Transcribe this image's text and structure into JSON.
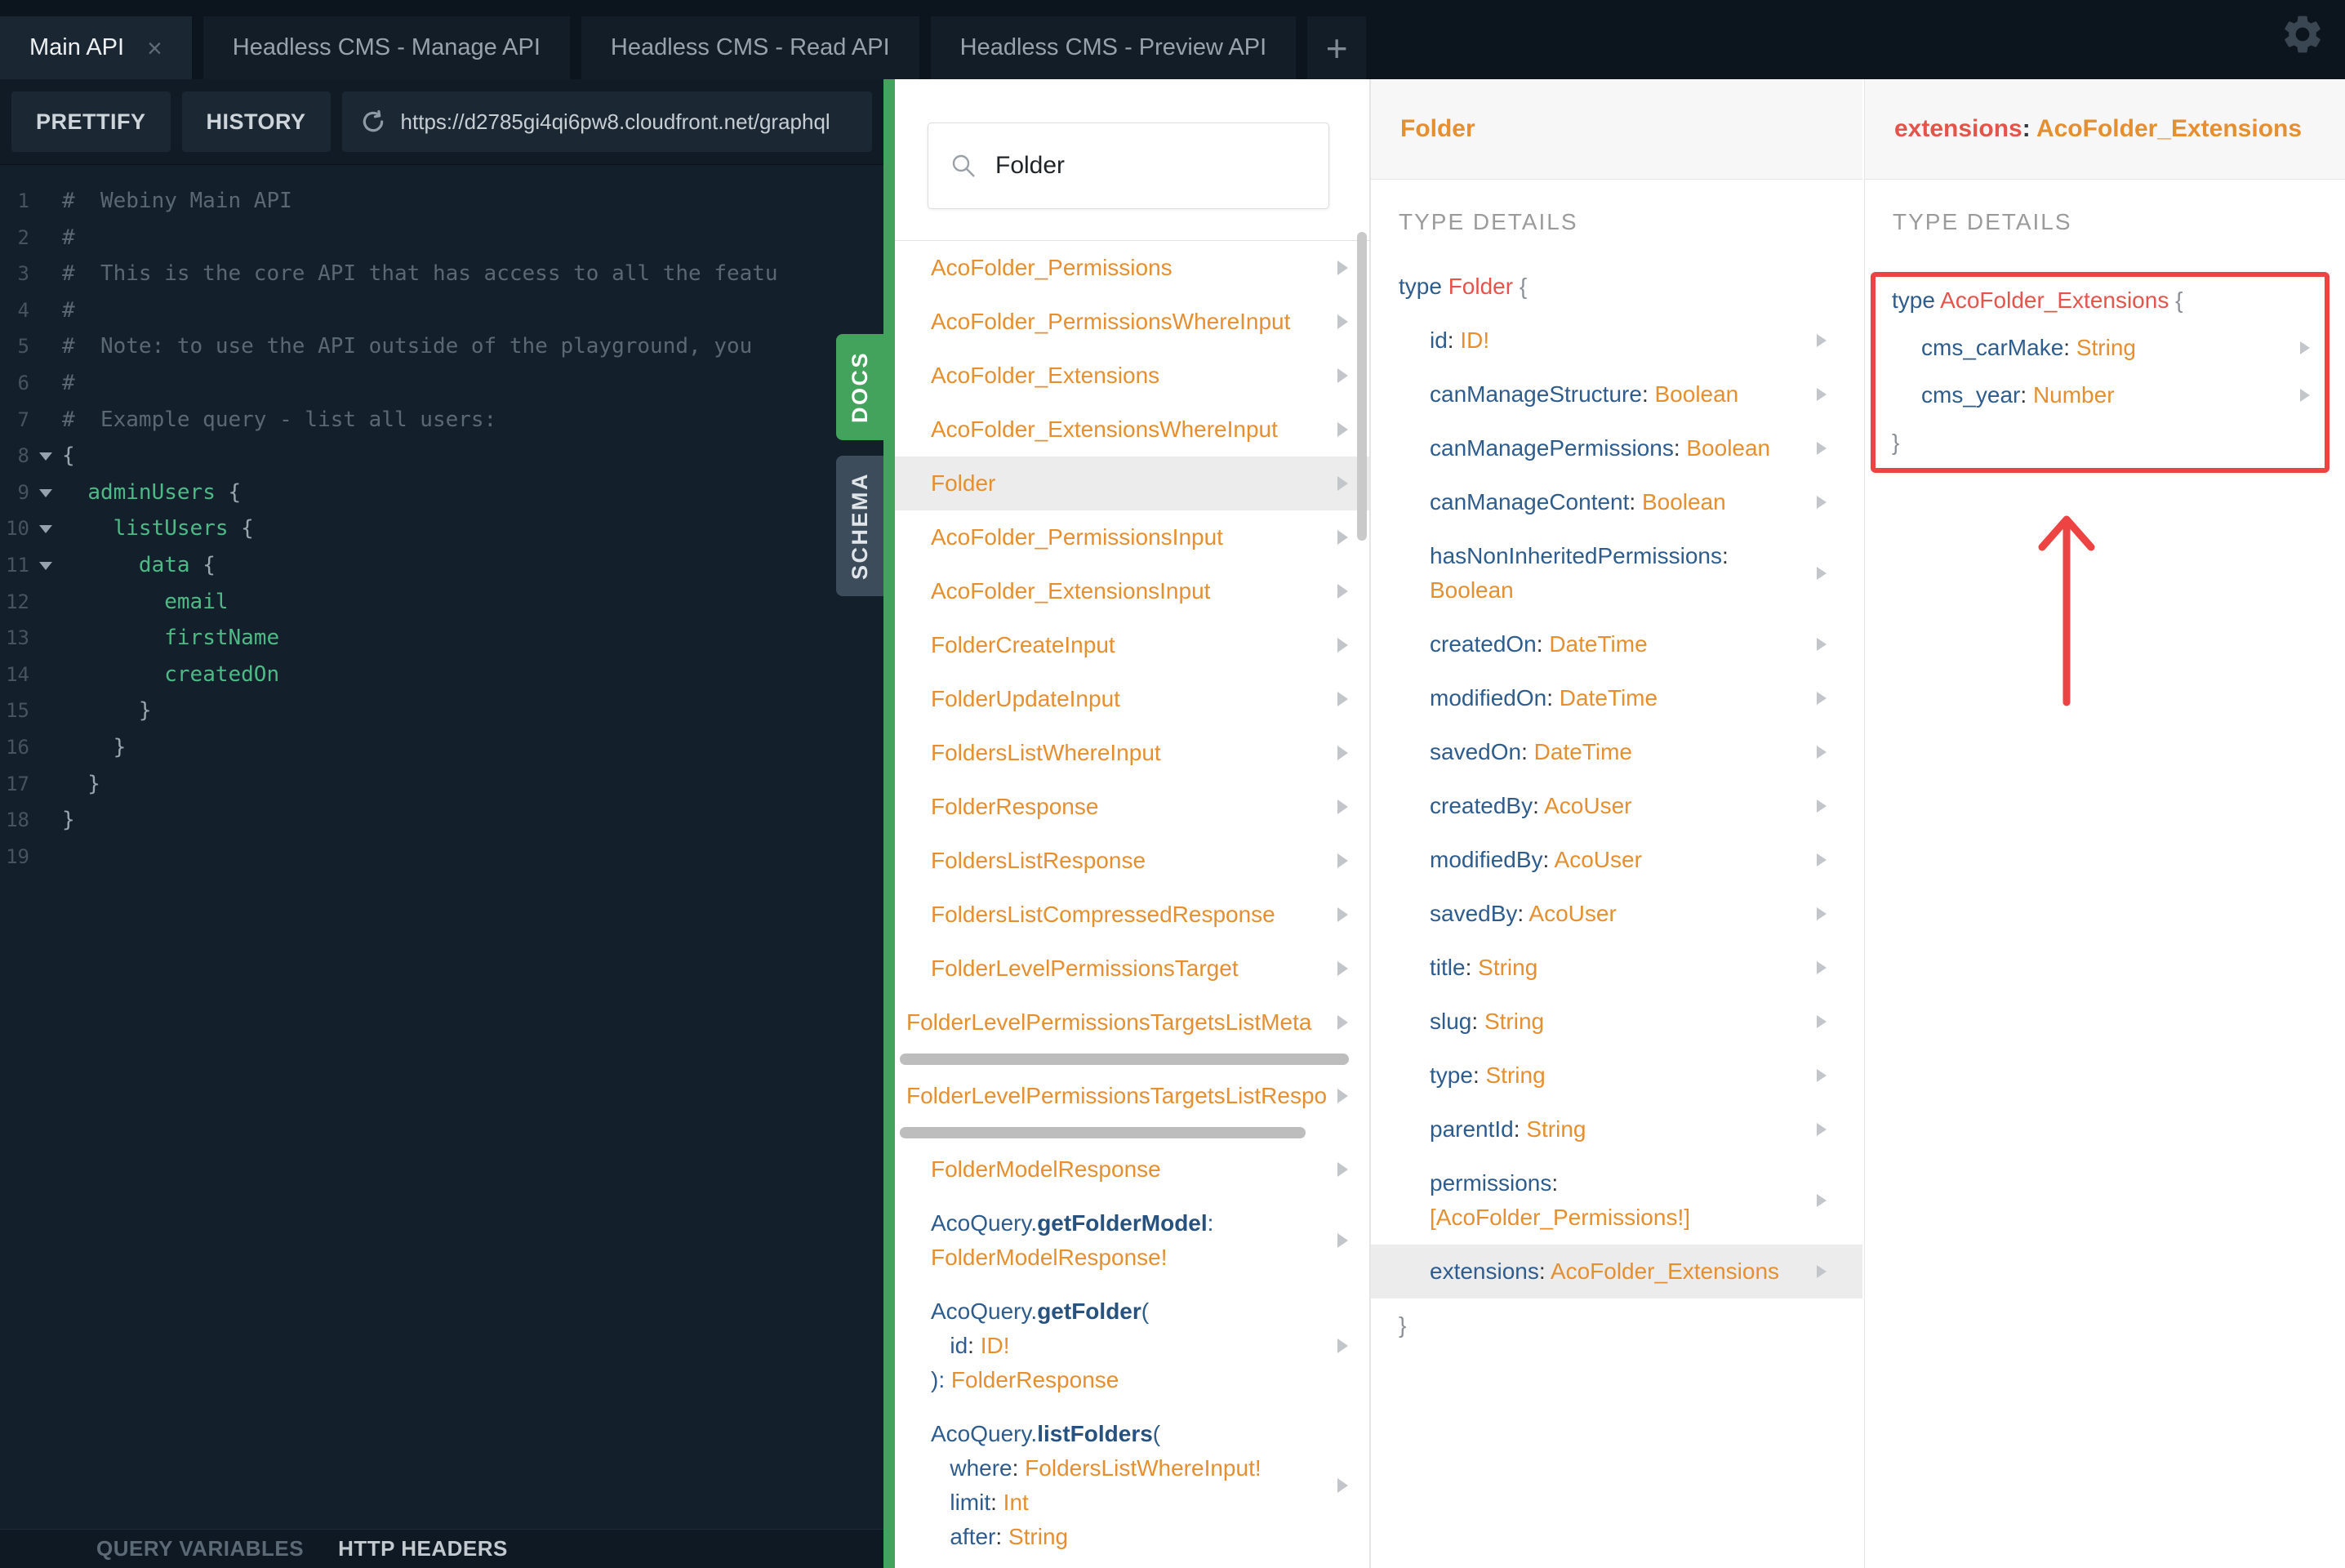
{
  "colors": {
    "accent_green": "#43a25b",
    "docs_orange": "#e58f30",
    "keyword_blue": "#2e5c8d",
    "type_red": "#e5544b",
    "annotation_red": "#ee4343",
    "code_green": "#4dba86"
  },
  "icons": {
    "gear": "settings-cog",
    "search": "magnifier",
    "reload": "circular-arrow",
    "chevron": "right-triangle",
    "fold": "down-triangle",
    "close": "×",
    "new_tab": "+"
  },
  "tabs": {
    "items": [
      {
        "label": "Main API",
        "active": true,
        "closable": true
      },
      {
        "label": "Headless CMS - Manage API",
        "active": false,
        "closable": false
      },
      {
        "label": "Headless CMS - Read API",
        "active": false,
        "closable": false
      },
      {
        "label": "Headless CMS - Preview API",
        "active": false,
        "closable": false
      }
    ],
    "new_tab_label": "+",
    "close_label": "×"
  },
  "toolbar": {
    "prettify": "PRETTIFY",
    "history": "HISTORY",
    "url": "https://d2785gi4qi6pw8.cloudfront.net/graphql"
  },
  "side_tabs": {
    "docs": "DOCS",
    "schema": "SCHEMA"
  },
  "bottom_bar": {
    "query_variables": "QUERY VARIABLES",
    "http_headers": "HTTP HEADERS"
  },
  "editor": {
    "lines": [
      {
        "n": 1,
        "fold": false,
        "seg": [
          {
            "t": "#  Webiny Main API",
            "c": "com"
          }
        ]
      },
      {
        "n": 2,
        "fold": false,
        "seg": [
          {
            "t": "#",
            "c": "com"
          }
        ]
      },
      {
        "n": 3,
        "fold": false,
        "seg": [
          {
            "t": "#  This is the core API that has access to all the featu",
            "c": "com"
          }
        ]
      },
      {
        "n": 4,
        "fold": false,
        "seg": [
          {
            "t": "#",
            "c": "com"
          }
        ]
      },
      {
        "n": 5,
        "fold": false,
        "seg": [
          {
            "t": "#  Note: to use the API outside of the playground, you",
            "c": "com"
          }
        ]
      },
      {
        "n": 6,
        "fold": false,
        "seg": [
          {
            "t": "#",
            "c": "com"
          }
        ]
      },
      {
        "n": 7,
        "fold": false,
        "seg": [
          {
            "t": "#  Example query - list all users:",
            "c": "com"
          }
        ]
      },
      {
        "n": 8,
        "fold": true,
        "seg": [
          {
            "t": "{",
            "c": "pun"
          }
        ]
      },
      {
        "n": 9,
        "fold": true,
        "seg": [
          {
            "t": "  ",
            "c": "pun"
          },
          {
            "t": "adminUsers",
            "c": "id"
          },
          {
            "t": " {",
            "c": "pun"
          }
        ]
      },
      {
        "n": 10,
        "fold": true,
        "seg": [
          {
            "t": "    ",
            "c": "pun"
          },
          {
            "t": "listUsers",
            "c": "id"
          },
          {
            "t": " {",
            "c": "pun"
          }
        ]
      },
      {
        "n": 11,
        "fold": true,
        "seg": [
          {
            "t": "      ",
            "c": "pun"
          },
          {
            "t": "data",
            "c": "id"
          },
          {
            "t": " {",
            "c": "pun"
          }
        ]
      },
      {
        "n": 12,
        "fold": false,
        "seg": [
          {
            "t": "        ",
            "c": "pun"
          },
          {
            "t": "email",
            "c": "id"
          }
        ]
      },
      {
        "n": 13,
        "fold": false,
        "seg": [
          {
            "t": "        ",
            "c": "pun"
          },
          {
            "t": "firstName",
            "c": "id"
          }
        ]
      },
      {
        "n": 14,
        "fold": false,
        "seg": [
          {
            "t": "        ",
            "c": "pun"
          },
          {
            "t": "createdOn",
            "c": "id"
          }
        ]
      },
      {
        "n": 15,
        "fold": false,
        "seg": [
          {
            "t": "      }",
            "c": "pun"
          }
        ]
      },
      {
        "n": 16,
        "fold": false,
        "seg": [
          {
            "t": "    }",
            "c": "pun"
          }
        ]
      },
      {
        "n": 17,
        "fold": false,
        "seg": [
          {
            "t": "  }",
            "c": "pun"
          }
        ]
      },
      {
        "n": 18,
        "fold": false,
        "seg": [
          {
            "t": "}",
            "c": "pun"
          }
        ]
      },
      {
        "n": 19,
        "fold": false,
        "seg": []
      }
    ]
  },
  "docs": {
    "search_value": "Folder",
    "items": [
      {
        "lines": [
          [
            {
              "t": "AcoFolder_Permissions",
              "c": "o"
            }
          ]
        ],
        "arrow": true
      },
      {
        "lines": [
          [
            {
              "t": "AcoFolder_PermissionsWhereInput",
              "c": "o"
            }
          ]
        ],
        "arrow": true
      },
      {
        "lines": [
          [
            {
              "t": "AcoFolder_Extensions",
              "c": "o"
            }
          ]
        ],
        "arrow": true
      },
      {
        "lines": [
          [
            {
              "t": "AcoFolder_ExtensionsWhereInput",
              "c": "o"
            }
          ]
        ],
        "arrow": true
      },
      {
        "lines": [
          [
            {
              "t": "Folder",
              "c": "o"
            }
          ]
        ],
        "arrow": true,
        "selected": true
      },
      {
        "lines": [
          [
            {
              "t": "AcoFolder_PermissionsInput",
              "c": "o"
            }
          ]
        ],
        "arrow": true
      },
      {
        "lines": [
          [
            {
              "t": "AcoFolder_ExtensionsInput",
              "c": "o"
            }
          ]
        ],
        "arrow": true
      },
      {
        "lines": [
          [
            {
              "t": "FolderCreateInput",
              "c": "o"
            }
          ]
        ],
        "arrow": true
      },
      {
        "lines": [
          [
            {
              "t": "FolderUpdateInput",
              "c": "o"
            }
          ]
        ],
        "arrow": true
      },
      {
        "lines": [
          [
            {
              "t": "FoldersListWhereInput",
              "c": "o"
            }
          ]
        ],
        "arrow": true
      },
      {
        "lines": [
          [
            {
              "t": "FolderResponse",
              "c": "o"
            }
          ]
        ],
        "arrow": true
      },
      {
        "lines": [
          [
            {
              "t": "FoldersListResponse",
              "c": "o"
            }
          ]
        ],
        "arrow": true
      },
      {
        "lines": [
          [
            {
              "t": "FoldersListCompressedResponse",
              "c": "o"
            }
          ]
        ],
        "arrow": true
      },
      {
        "lines": [
          [
            {
              "t": "FolderLevelPermissionsTarget",
              "c": "o"
            }
          ]
        ],
        "arrow": true
      },
      {
        "lines": [
          [
            {
              "t": "FolderLevelPermissionsTargetsListMeta",
              "c": "o"
            }
          ]
        ],
        "arrow": true,
        "scrolled": true
      },
      {
        "hbar": 550
      },
      {
        "lines": [
          [
            {
              "t": "FolderLevelPermissionsTargetsListRespo",
              "c": "o"
            }
          ]
        ],
        "arrow": true,
        "scrolled": true
      },
      {
        "hbar": 497
      },
      {
        "lines": [
          [
            {
              "t": "FolderModelResponse",
              "c": "o"
            }
          ]
        ],
        "arrow": true
      },
      {
        "lines": [
          [
            {
              "t": "AcoQuery.",
              "c": "b"
            },
            {
              "t": "getFolderModel",
              "c": "bb"
            },
            {
              "t": ":",
              "c": "b"
            }
          ],
          [
            {
              "t": "FolderModelResponse!",
              "c": "o"
            }
          ]
        ],
        "arrow": true
      },
      {
        "lines": [
          [
            {
              "t": "AcoQuery.",
              "c": "b"
            },
            {
              "t": "getFolder",
              "c": "bb"
            },
            {
              "t": "(",
              "c": "b"
            }
          ],
          [
            {
              "t": "   ",
              "c": "b"
            },
            {
              "t": "id",
              "c": "b"
            },
            {
              "t": ": ",
              "c": "d"
            },
            {
              "t": "ID!",
              "c": "o"
            }
          ],
          [
            {
              "t": "): ",
              "c": "b"
            },
            {
              "t": "FolderResponse",
              "c": "o"
            }
          ]
        ],
        "arrow": true
      },
      {
        "lines": [
          [
            {
              "t": "AcoQuery.",
              "c": "b"
            },
            {
              "t": "listFolders",
              "c": "bb"
            },
            {
              "t": "(",
              "c": "b"
            }
          ],
          [
            {
              "t": "   ",
              "c": "b"
            },
            {
              "t": "where",
              "c": "b"
            },
            {
              "t": ": ",
              "c": "d"
            },
            {
              "t": "FoldersListWhereInput!",
              "c": "o"
            }
          ],
          [
            {
              "t": "   ",
              "c": "b"
            },
            {
              "t": "limit",
              "c": "b"
            },
            {
              "t": ": ",
              "c": "d"
            },
            {
              "t": "Int",
              "c": "o"
            }
          ],
          [
            {
              "t": "   ",
              "c": "b"
            },
            {
              "t": "after",
              "c": "b"
            },
            {
              "t": ": ",
              "c": "d"
            },
            {
              "t": "String",
              "c": "o"
            }
          ]
        ],
        "arrow": true
      }
    ]
  },
  "type_panel": {
    "title": "Folder",
    "section_label": "TYPE DETAILS",
    "signature": [
      {
        "t": "type ",
        "c": "b"
      },
      {
        "t": "Folder",
        "c": "r"
      },
      {
        "t": " {",
        "c": "g"
      }
    ],
    "fields": [
      {
        "name": "id",
        "type": "ID!"
      },
      {
        "name": "canManageStructure",
        "type": "Boolean"
      },
      {
        "name": "canManagePermissions",
        "type": "Boolean"
      },
      {
        "name": "canManageContent",
        "type": "Boolean"
      },
      {
        "name": "hasNonInheritedPermissions",
        "type": "Boolean",
        "wrap": true
      },
      {
        "name": "createdOn",
        "type": "DateTime"
      },
      {
        "name": "modifiedOn",
        "type": "DateTime"
      },
      {
        "name": "savedOn",
        "type": "DateTime"
      },
      {
        "name": "createdBy",
        "type": "AcoUser"
      },
      {
        "name": "modifiedBy",
        "type": "AcoUser"
      },
      {
        "name": "savedBy",
        "type": "AcoUser"
      },
      {
        "name": "title",
        "type": "String"
      },
      {
        "name": "slug",
        "type": "String"
      },
      {
        "name": "type",
        "type": "String"
      },
      {
        "name": "parentId",
        "type": "String"
      },
      {
        "name": "permissions",
        "type": "[AcoFolder_Permissions!]",
        "wrap": true
      },
      {
        "name": "extensions",
        "type": "AcoFolder_Extensions",
        "selected": true
      }
    ],
    "closing": "}"
  },
  "extension_panel": {
    "header": [
      {
        "t": "extensions",
        "c": "r"
      },
      {
        "t": ": ",
        "c": "d"
      },
      {
        "t": "AcoFolder_Extensions",
        "c": "o"
      }
    ],
    "section_label": "TYPE DETAILS",
    "signature": [
      {
        "t": "type ",
        "c": "b"
      },
      {
        "t": "AcoFolder_Extensions",
        "c": "r"
      },
      {
        "t": " {",
        "c": "g"
      }
    ],
    "fields": [
      {
        "name": "cms_carMake",
        "type": "String"
      },
      {
        "name": "cms_year",
        "type": "Number"
      }
    ],
    "closing": "}"
  },
  "annotations": {
    "highlight_box_color": "#ee4343",
    "arrow_color": "#ee4343",
    "arrow_direction": "up"
  }
}
